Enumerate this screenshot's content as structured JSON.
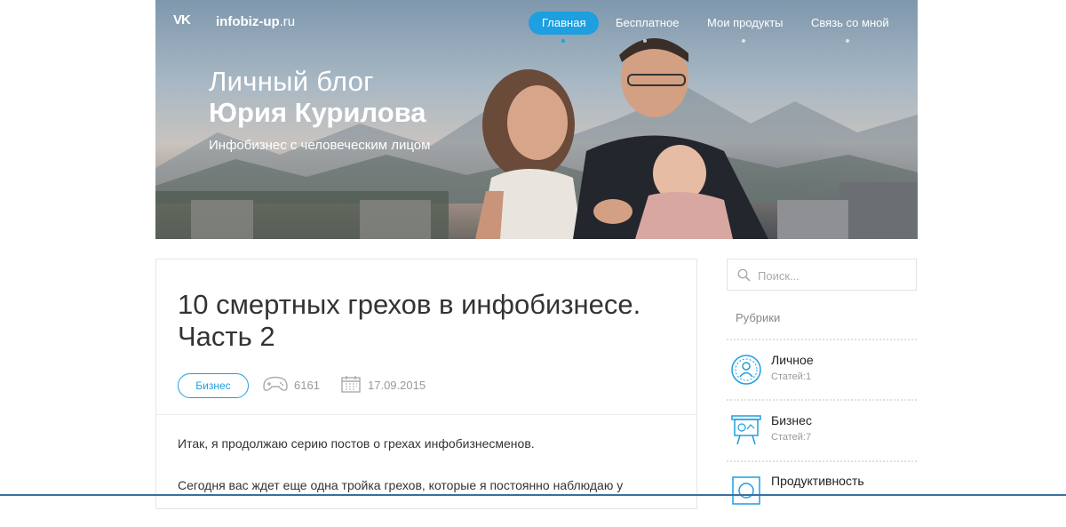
{
  "header": {
    "vk_label": "VK",
    "site_name": "infobiz-up",
    "site_tld": ".ru",
    "nav": [
      {
        "label": "Главная",
        "active": true
      },
      {
        "label": "Бесплатное",
        "active": false
      },
      {
        "label": "Мои продукты",
        "active": false
      },
      {
        "label": "Связь со мной",
        "active": false
      }
    ],
    "title_line1": "Личный блог",
    "title_line2": "Юрия Курилова",
    "subtitle": "Инфобизнес с человеческим лицом"
  },
  "article": {
    "title": "10 смертных грехов в инфобизнесе. Часть 2",
    "tag": "Бизнес",
    "views": "6161",
    "date": "17.09.2015",
    "paragraph1": "Итак, я продолжаю серию постов о грехах инфобизнесменов.",
    "paragraph2": "Сегодня вас ждет еще одна тройка грехов, которые я постоянно наблюдаю у"
  },
  "sidebar": {
    "search_placeholder": "Поиск...",
    "rubrics_title": "Рубрики",
    "categories": [
      {
        "name": "Личное",
        "count": "Статей:1",
        "icon": "person-icon"
      },
      {
        "name": "Бизнес",
        "count": "Статей:7",
        "icon": "presentation-board-icon"
      },
      {
        "name": "Продуктивность",
        "count": "",
        "icon": "productivity-icon"
      }
    ]
  },
  "colors": {
    "accent": "#1d9fe0",
    "text": "#333333",
    "muted": "#999999"
  }
}
